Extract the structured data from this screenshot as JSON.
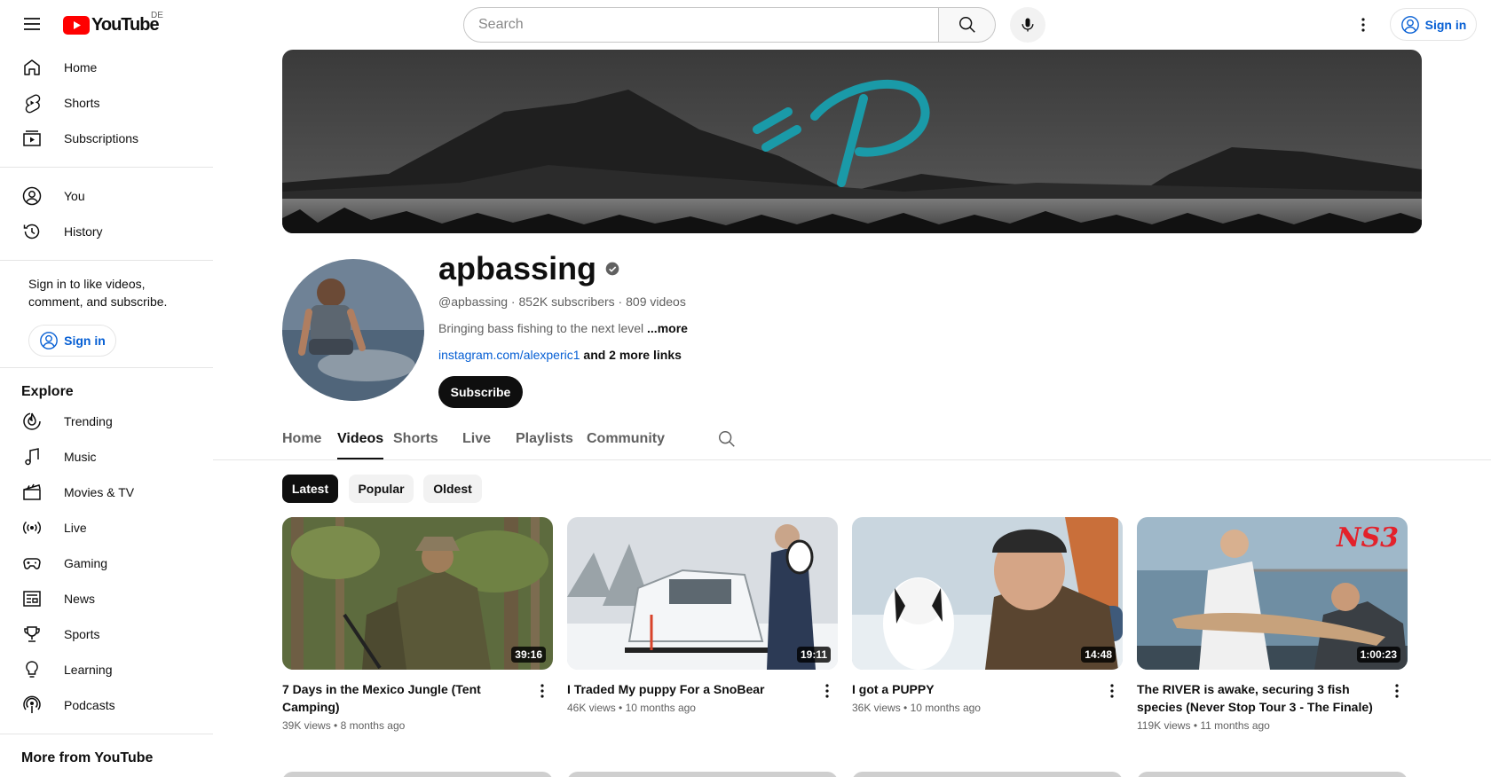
{
  "topbar": {
    "logo_text": "YouTube",
    "country": "DE",
    "search_placeholder": "Search",
    "signin_label": "Sign in"
  },
  "sidebar": {
    "main": [
      {
        "label": "Home",
        "icon": "home-icon"
      },
      {
        "label": "Shorts",
        "icon": "shorts-icon"
      },
      {
        "label": "Subscriptions",
        "icon": "subscriptions-icon"
      }
    ],
    "you": [
      {
        "label": "You",
        "icon": "you-icon"
      },
      {
        "label": "History",
        "icon": "history-icon"
      }
    ],
    "signin_prompt": "Sign in to like videos, comment, and subscribe.",
    "signin_label": "Sign in",
    "explore_heading": "Explore",
    "explore": [
      {
        "label": "Trending",
        "icon": "trending-icon"
      },
      {
        "label": "Music",
        "icon": "music-icon"
      },
      {
        "label": "Movies & TV",
        "icon": "movies-icon"
      },
      {
        "label": "Live",
        "icon": "live-icon"
      },
      {
        "label": "Gaming",
        "icon": "gaming-icon"
      },
      {
        "label": "News",
        "icon": "news-icon"
      },
      {
        "label": "Sports",
        "icon": "sports-icon"
      },
      {
        "label": "Learning",
        "icon": "learning-icon"
      },
      {
        "label": "Podcasts",
        "icon": "podcasts-icon"
      }
    ],
    "more_heading": "More from YouTube"
  },
  "channel": {
    "name": "apbassing",
    "handle": "@apbassing",
    "subscribers": "852K subscribers",
    "videos_count": "809 videos",
    "description": "Bringing bass fishing to the next level",
    "more_label": "...more",
    "link": "instagram.com/alexperic1",
    "more_links": "and 2 more links",
    "subscribe_label": "Subscribe"
  },
  "tabs": [
    "Home",
    "Videos",
    "Shorts",
    "Live",
    "Playlists",
    "Community"
  ],
  "active_tab": "Videos",
  "chips": [
    "Latest",
    "Popular",
    "Oldest"
  ],
  "active_chip": "Latest",
  "videos": [
    {
      "title": "7 Days in the Mexico Jungle (Tent Camping)",
      "views": "39K views",
      "age": "8 months ago",
      "duration": "39:16"
    },
    {
      "title": "I Traded My puppy For a SnoBear",
      "views": "46K views",
      "age": "10 months ago",
      "duration": "19:11"
    },
    {
      "title": "I got a PUPPY",
      "views": "36K views",
      "age": "10 months ago",
      "duration": "14:48"
    },
    {
      "title": "The RIVER is awake, securing 3 fish species (Never Stop Tour 3 - The Finale)",
      "views": "119K views",
      "age": "11 months ago",
      "duration": "1:00:23"
    }
  ],
  "thumb4_badge": "NS3",
  "colors": {
    "accent_blue": "#065fd4",
    "brand_red": "#ff0000",
    "logo_teal": "#1a9aa8"
  }
}
